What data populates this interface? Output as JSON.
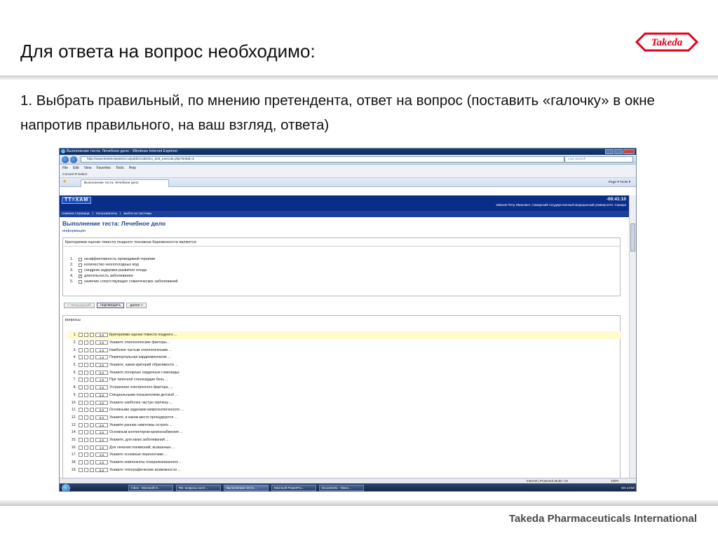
{
  "slide": {
    "title": "Для ответа на вопрос необходимо:",
    "instruction": "1. Выбрать правильный, по мнению претендента, ответ на вопрос (поставить «галочку» в окне напротив правильного, на ваш взгляд, ответа)",
    "company": "Takeda Pharmaceuticals International",
    "logo_text": "Takeda",
    "logo_color": "#e2001a"
  },
  "browser": {
    "window_title": "Выполнение теста: Лечебное дело - Windows Internet Explorer",
    "url": "http://www.bestinclasstest.ru/public/code/tco_test_execute.php?testid=3",
    "search_placeholder": "Live Search",
    "menu": [
      "File",
      "Edit",
      "View",
      "Favorites",
      "Tools",
      "Help"
    ],
    "convert_bar": "Convert ▾  Select",
    "tab_label": "Выполнение теста: Лечебное дело",
    "tools_bar": "Page ▾  Tools ▾",
    "status_zone": "Internet | Protected Mode: On",
    "zoom": "100%"
  },
  "site": {
    "logo": "TT=XAM",
    "timer": "-00:41:10",
    "user": "Иванов Пётр Иванович, Самарский государственный медицинский университет, Самара",
    "nav": [
      "главная страница",
      "пользователь",
      "выйти из системы"
    ],
    "page_title": "Выполнение теста: Лечебное дело",
    "info_link": "информация",
    "accent": "#0a2e87"
  },
  "question": {
    "text": "Критериями оценки тяжести позднего токсикоза беременности являются:",
    "options": [
      {
        "num": "1.",
        "label": "неэффективность проводимой терапии",
        "checked": false
      },
      {
        "num": "2.",
        "label": "количество околоплодных вод",
        "checked": false
      },
      {
        "num": "3.",
        "label": "синдром задержки развития плода",
        "checked": false
      },
      {
        "num": "4.",
        "label": "длительность заболевания",
        "checked": true
      },
      {
        "num": "5.",
        "label": "наличие сопутствующих соматических заболеваний",
        "checked": false
      }
    ]
  },
  "buttons": {
    "prev": "< предыдущий",
    "confirm": "подтвердить",
    "next": "далее >"
  },
  "questions_panel": {
    "title": "вопросы",
    "items": [
      {
        "n": "1.",
        "pts": "5.0",
        "text": "Критериями оценки тяжести позднего ..."
      },
      {
        "n": "2.",
        "pts": "3.0",
        "text": "Укажите этиологические факторы..."
      },
      {
        "n": "3.",
        "pts": "2.0",
        "text": "Наиболее частым этиологическим ..."
      },
      {
        "n": "4.",
        "pts": "1.0",
        "text": "Перипортальная кардиомиопатия ..."
      },
      {
        "n": "5.",
        "pts": "2.0",
        "text": "Укажите, каков критерий обратимости ..."
      },
      {
        "n": "6.",
        "pts": "5.0",
        "text": "Укажите полярные сердечные гликозиды:"
      },
      {
        "n": "7.",
        "pts": "1.0",
        "text": "При типичной стенокардии боль ..."
      },
      {
        "n": "8.",
        "pts": "3.0",
        "text": "Устранение этиотропного фактора, ..."
      },
      {
        "n": "9.",
        "pts": "5.0",
        "text": "Специальными показателями детской ..."
      },
      {
        "n": "10.",
        "pts": "4.0",
        "text": "Укажите наиболее частую причину ..."
      },
      {
        "n": "11.",
        "pts": "5.0",
        "text": "Основными задачами микроскопического ..."
      },
      {
        "n": "12.",
        "pts": "5.0",
        "text": "Укажите, в каком месте проецируется ..."
      },
      {
        "n": "13.",
        "pts": "3.0",
        "text": "Укажите ранние симптомы острого ..."
      },
      {
        "n": "14.",
        "pts": "3.0",
        "text": "Основным коллектором кровоснабжения ..."
      },
      {
        "n": "15.",
        "pts": "2.0",
        "text": "Укажите, для каких заболеваний ..."
      },
      {
        "n": "16.",
        "pts": "1.0",
        "text": "Для лечения пневмоний, вызванных ..."
      },
      {
        "n": "17.",
        "pts": "4.0",
        "text": "Укажите основные переносчики ..."
      },
      {
        "n": "18.",
        "pts": "4.0",
        "text": "Укажите компоненты генерализованного ..."
      },
      {
        "n": "19.",
        "pts": "5.0",
        "text": "Укажите топографические возможности ..."
      }
    ]
  },
  "taskbar": {
    "tasks": [
      "Inbox - Microsoft O...",
      "RE: вопросы колл ...",
      "Выполнение теста ...",
      "Microsoft PowerPoi...",
      "Document1 - Micro..."
    ],
    "tray": "EN  13:50"
  }
}
